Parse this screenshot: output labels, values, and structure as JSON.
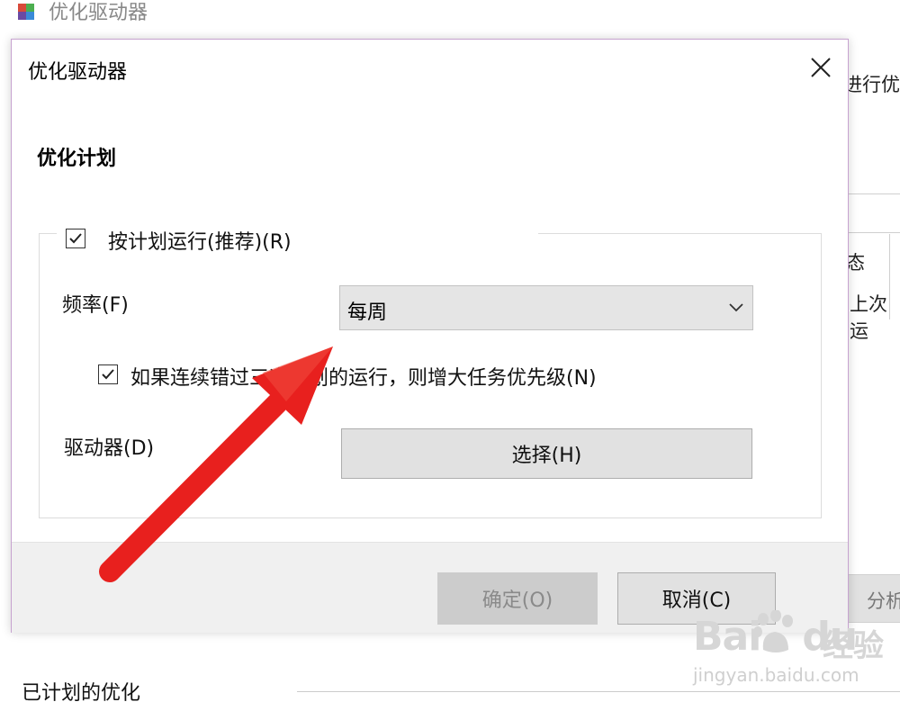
{
  "background_window": {
    "title": "优化驱动器",
    "right_texts": [
      "进行优",
      "态",
      "上次运",
      "分析"
    ],
    "bottom_label": "已计划的优化"
  },
  "dialog": {
    "title": "优化驱动器",
    "section_heading": "优化计划",
    "schedule_checkbox": {
      "label": "按计划运行(推荐)(R)",
      "checked": true
    },
    "frequency": {
      "label": "频率(F)",
      "selected": "每周"
    },
    "priority_checkbox": {
      "label": "如果连续错过三次计划的运行，则增大任务优先级(N)",
      "checked": true
    },
    "drives": {
      "label": "驱动器(D)",
      "button_label": "选择(H)"
    },
    "ok_button": "确定(O)",
    "cancel_button": "取消(C)"
  },
  "watermark": {
    "logo_left": "Bai",
    "logo_right": "du",
    "brand_cn": "经验",
    "url": "jingyan.baidu.com"
  },
  "colors": {
    "arrow": "#e8201e",
    "dialog_border": "#c7a3d0",
    "button_face": "#e1e1e1",
    "disabled_button": "#cccccc"
  }
}
